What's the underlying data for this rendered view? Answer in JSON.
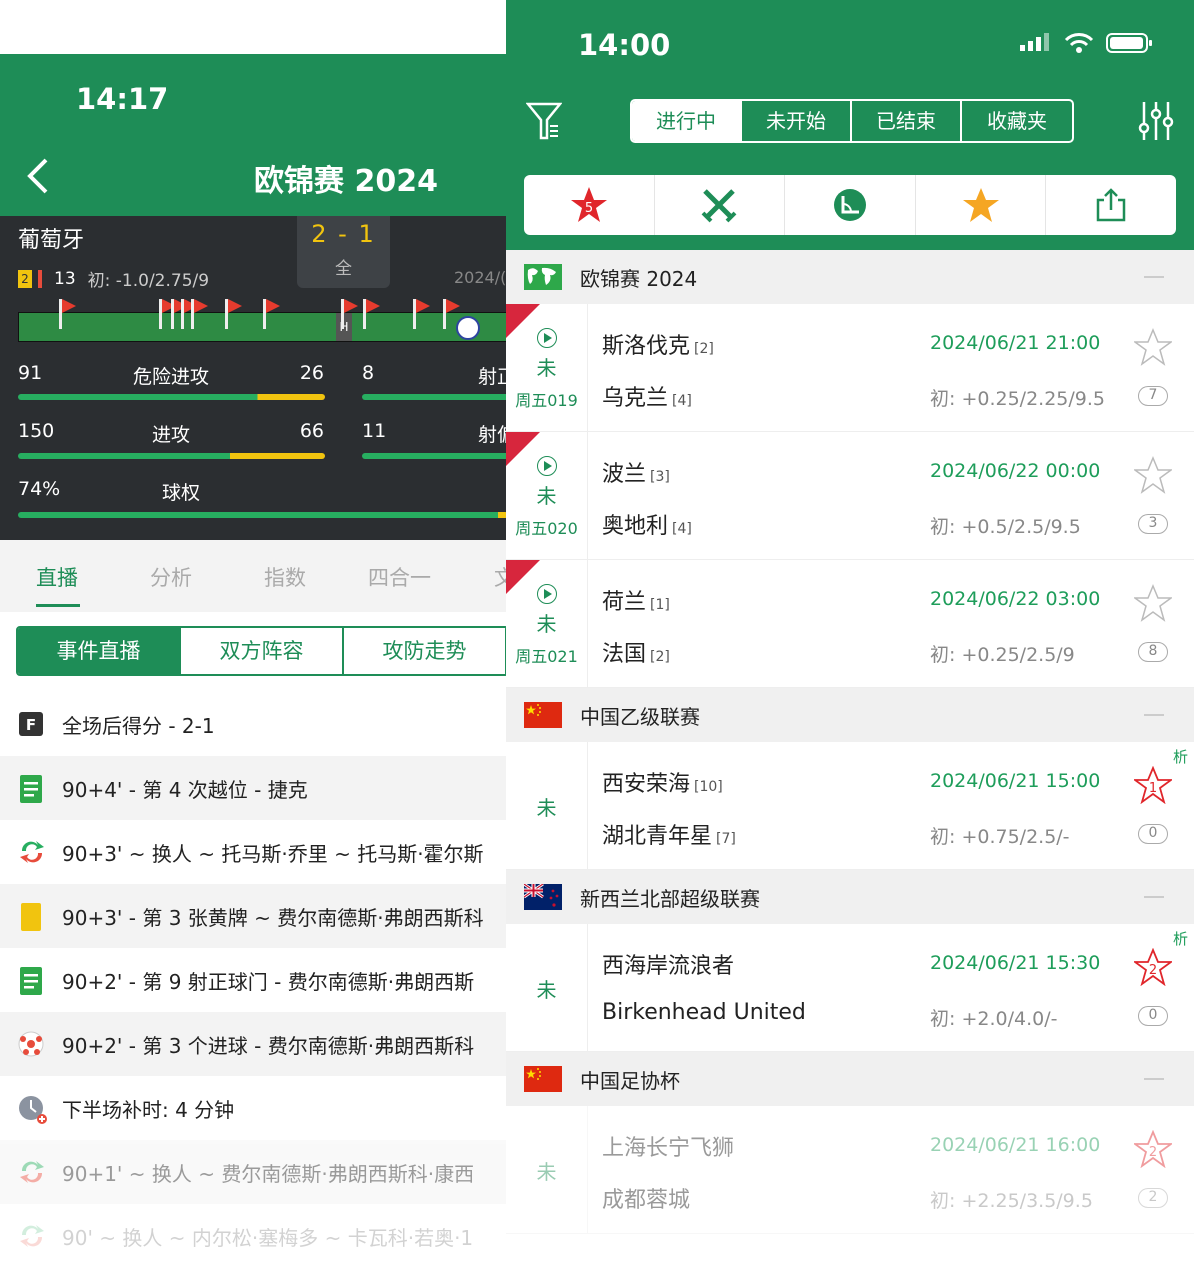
{
  "left": {
    "status_time": "14:17",
    "title": "欧锦赛 2024",
    "home_team": "葡萄牙",
    "score": "2 - 1",
    "score_label": "全",
    "yellow_count": "2",
    "corners": "13",
    "initial_odds": "初: -1.0/2.75/9",
    "date_partial": "2024/(",
    "halftime_marker": "H",
    "stats": [
      {
        "name": "危险进攻",
        "home": "91",
        "away": "26",
        "home_frac": 0.78
      },
      {
        "name": "进攻",
        "home": "150",
        "away": "66",
        "home_frac": 0.69
      },
      {
        "name": "球权",
        "home": "74%",
        "away": "",
        "home_frac": 0.98
      }
    ],
    "stats_right": [
      {
        "name": "射正",
        "home": "8"
      },
      {
        "name": "射偏",
        "home": "11"
      }
    ],
    "tabs": [
      "直播",
      "分析",
      "指数",
      "四合一",
      "文"
    ],
    "segments": [
      "事件直播",
      "双方阵容",
      "攻防走势"
    ],
    "events": [
      {
        "icon": "full-time-icon",
        "text": "全场后得分 - 2-1"
      },
      {
        "icon": "stats-icon",
        "text": "90+4' - 第 4 次越位 - 捷克"
      },
      {
        "icon": "substitution-icon",
        "text": "90+3' ~ 换人 ~ 托马斯·乔里 ~ 托马斯·霍尔斯"
      },
      {
        "icon": "yellow-card-icon",
        "text": "90+3' - 第 3 张黄牌 ~ 费尔南德斯·弗朗西斯科"
      },
      {
        "icon": "stats-icon",
        "text": "90+2' - 第 9 射正球门 - 费尔南德斯·弗朗西斯"
      },
      {
        "icon": "goal-ball-icon",
        "text": "90+2' - 第 3 个进球 - 费尔南德斯·弗朗西斯科"
      },
      {
        "icon": "clock-icon",
        "text": "下半场补时: 4 分钟"
      },
      {
        "icon": "substitution-icon",
        "text": "90+1' ~ 换人 ~ 费尔南德斯·弗朗西斯科·康西"
      },
      {
        "icon": "substitution-icon",
        "text": "90' ~ 换人 ~ 内尔松·塞梅多 ~ 卡瓦科·若奥·1"
      }
    ]
  },
  "right": {
    "status_time": "14:00",
    "segments": [
      "进行中",
      "未开始",
      "已结束",
      "收藏夹"
    ],
    "badge_count": "5",
    "leagues": [
      {
        "name": "欧锦赛 2024",
        "flag": "world",
        "matches": [
          {
            "status": "未",
            "week": "周五019",
            "home": "斯洛伐克",
            "home_rank": "[2]",
            "away": "乌克兰",
            "away_rank": "[4]",
            "datetime": "2024/06/21 21:00",
            "odds": "初: +0.25/2.25/9.5",
            "count": "7",
            "star_num": ""
          },
          {
            "status": "未",
            "week": "周五020",
            "home": "波兰",
            "home_rank": "[3]",
            "away": "奥地利",
            "away_rank": "[4]",
            "datetime": "2024/06/22 00:00",
            "odds": "初: +0.5/2.5/9.5",
            "count": "3",
            "star_num": ""
          },
          {
            "status": "未",
            "week": "周五021",
            "home": "荷兰",
            "home_rank": "[1]",
            "away": "法国",
            "away_rank": "[2]",
            "datetime": "2024/06/22 03:00",
            "odds": "初: +0.25/2.5/9",
            "count": "8",
            "star_num": ""
          }
        ]
      },
      {
        "name": "中国乙级联赛",
        "flag": "china",
        "matches": [
          {
            "status": "未",
            "week": "",
            "home": "西安荣海",
            "home_rank": "[10]",
            "away": "湖北青年星",
            "away_rank": "[7]",
            "datetime": "2024/06/21 15:00",
            "odds": "初: +0.75/2.5/-",
            "count": "0",
            "star_num": "1",
            "tag": "析"
          }
        ]
      },
      {
        "name": "新西兰北部超级联赛",
        "flag": "nz",
        "matches": [
          {
            "status": "未",
            "week": "",
            "home": "西海岸流浪者",
            "home_rank": "",
            "away": "Birkenhead United",
            "away_rank": "",
            "datetime": "2024/06/21 15:30",
            "odds": "初: +2.0/4.0/-",
            "count": "0",
            "star_num": "2",
            "tag": "析"
          }
        ]
      },
      {
        "name": "中国足协杯",
        "flag": "china",
        "matches": [
          {
            "status": "未",
            "week": "",
            "home": "上海长宁飞狮",
            "home_rank": "",
            "away": "成都蓉城",
            "away_rank": "",
            "datetime": "2024/06/21 16:00",
            "odds": "初: +2.25/3.5/9.5",
            "count": "2",
            "star_num": "2"
          }
        ]
      }
    ]
  },
  "colors": {
    "brand_green": "#1e8d57",
    "red": "#d7263d",
    "yellow": "#f1c40f"
  }
}
